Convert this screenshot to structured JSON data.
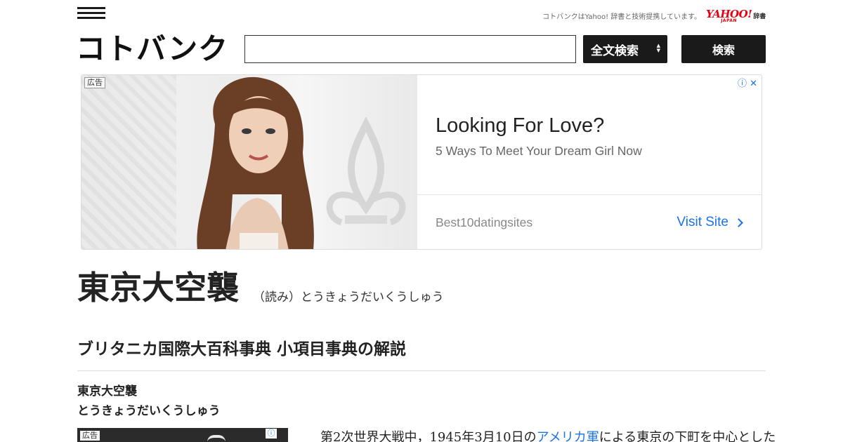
{
  "header": {
    "menu_icon": "hamburger-icon",
    "partner_text": "コトバンクはYahoo! 辞書と技術提携しています。",
    "yahoo_logo": {
      "word": "YAHOO!",
      "sub": "JAPAN",
      "suffix": "辞書"
    },
    "logo": "コトバンク"
  },
  "search": {
    "input_value": "",
    "select_label": "全文検索",
    "button_label": "検索"
  },
  "ad": {
    "label": "広告",
    "headline": "Looking For Love?",
    "subline": "5 Ways To Meet Your Dream Girl Now",
    "advertiser": "Best10datingsites",
    "cta": "Visit Site",
    "icons": [
      "info-icon",
      "close-icon"
    ]
  },
  "article": {
    "title": "東京大空襲",
    "reading": "（読み）とうきょうだいくうしゅう",
    "source_name": "ブリタニカ国際大百科事典 小項目事典",
    "source_suffix": "の解説",
    "entry_term": "東京大空襲",
    "entry_reading": "とうきょうだいくうしゅう",
    "body_prefix": "第2次世界大戦中，1945年3月10日の",
    "body_link": "アメリカ軍",
    "body_suffix": "による東京の下町を中心とした"
  },
  "small_ad": {
    "label": "広告",
    "info_icon": "info-icon"
  },
  "colors": {
    "accent": "#1a73e8",
    "dark_button": "#1a1a1a",
    "yahoo_red": "#e60012"
  }
}
